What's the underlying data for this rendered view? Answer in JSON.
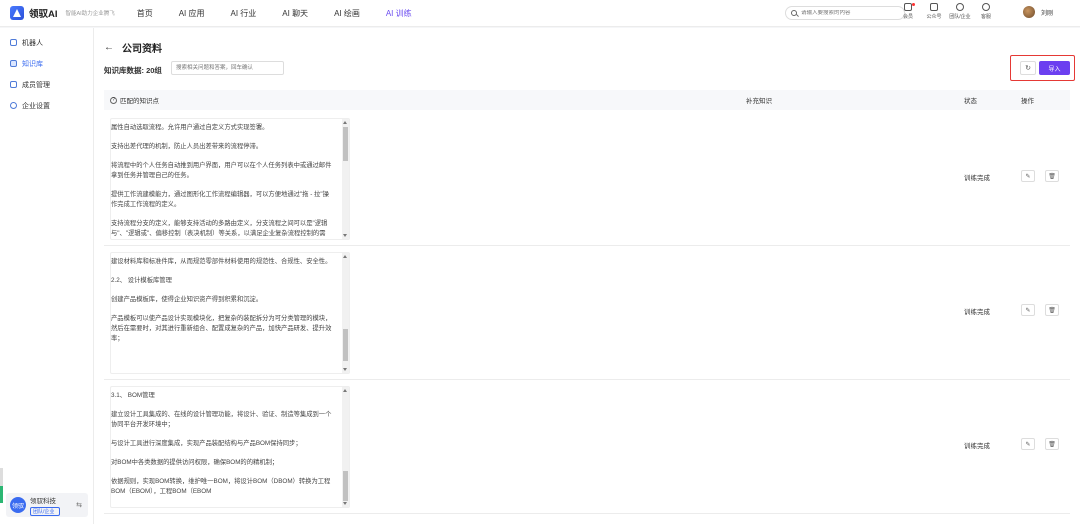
{
  "header": {
    "brand": "领驭AI",
    "slogan": "智能AI助力企业腾飞",
    "nav": [
      "首页",
      "AI 应用",
      "AI 行业",
      "AI 聊天",
      "AI 绘画",
      "AI 训练"
    ],
    "active_nav": "AI 训练",
    "search_placeholder": "请输入要搜索的内容",
    "icons": [
      {
        "label": "会员",
        "icon": "crown-icon"
      },
      {
        "label": "公众号",
        "icon": "phone-icon"
      },
      {
        "label": "团队/企业",
        "icon": "team-icon"
      },
      {
        "label": "客服",
        "icon": "headset-icon"
      }
    ],
    "user_name": "刘刚"
  },
  "sidebar": {
    "items": [
      {
        "label": "机器人",
        "icon": "robot-icon"
      },
      {
        "label": "知识库",
        "icon": "book-icon"
      },
      {
        "label": "成员管理",
        "icon": "members-icon"
      },
      {
        "label": "企业设置",
        "icon": "settings-icon"
      }
    ],
    "active": "知识库",
    "org": {
      "avatar_text": "领驭",
      "name": "领驭科技",
      "tag": "团队/企业"
    },
    "progress_fraction": 0.5
  },
  "page": {
    "title": "公司资料",
    "kb_count_label": "知识库数据: 20组",
    "search_placeholder": "搜索相关问题和答案，回车确认",
    "refresh_icon": "↻",
    "import_label": "导入"
  },
  "table": {
    "columns": [
      "匹配的知识点",
      "补充知识",
      "状态",
      "操作"
    ],
    "rows": [
      {
        "paragraphs": [
          "属性自动选取流程。允许用户通过自定义方式实现签署。",
          "支持出差代理的机制，防止人员出差带来的流程停滞。",
          "将流程中的个人任务自动推到用户界面，用户可以在个人任务列表中或通过邮件拿到任务并管理自己的任务。",
          "提供工作流建模能力，通过图形化工作流程编辑器，可以方便地通过\"拖 - 拉\"操作完成工作流程的定义。",
          "支持流程分支的定义，能够支持活动的多路由定义，分支流程之间可以是\"逻辑与\"、\"逻辑或\"、偏移控制（表决机制）等关系，以满足企业复杂流程控制的需要。"
        ],
        "status": "训练完成"
      },
      {
        "paragraphs": [
          "建设材料库和标准件库，从而规范零部件材料使用的规范性、合规性、安全性。",
          "2.2、 设计模板库管理",
          "创建产品模板库，使得企业知识资产得到积累和沉淀。",
          "产品模板可以使产品设计实现模块化，把复杂的装配拆分为可分类管理的模块，然后在需要时，对其进行重新组合、配置成复杂的产品，加快产品研发、提升效率；"
        ],
        "status": "训练完成"
      },
      {
        "paragraphs": [
          "3.1、 BOM管理",
          "建立设计工具集成的、在线的设计管理功能，将设计、验证、制造等集成到一个协同平台开发环境中；",
          "与设计工具进行深度集成，实现产品装配结构与产品BOM保持同步；",
          "对BOM中各类数据的提供访问权限，确保BOM的的精机制；",
          "依据规则，实现BOM转换，维护唯一BOM，将设计BOM（DBOM）转换为工程BOM（EBOM），工程BOM（EBOM"
        ],
        "status": "训练完成"
      }
    ],
    "edit_icon": "✎",
    "delete_icon": "🗑"
  },
  "colors": {
    "accent": "#6b3ff0",
    "brand": "#3a6bf0",
    "highlight_border": "#e53935"
  }
}
